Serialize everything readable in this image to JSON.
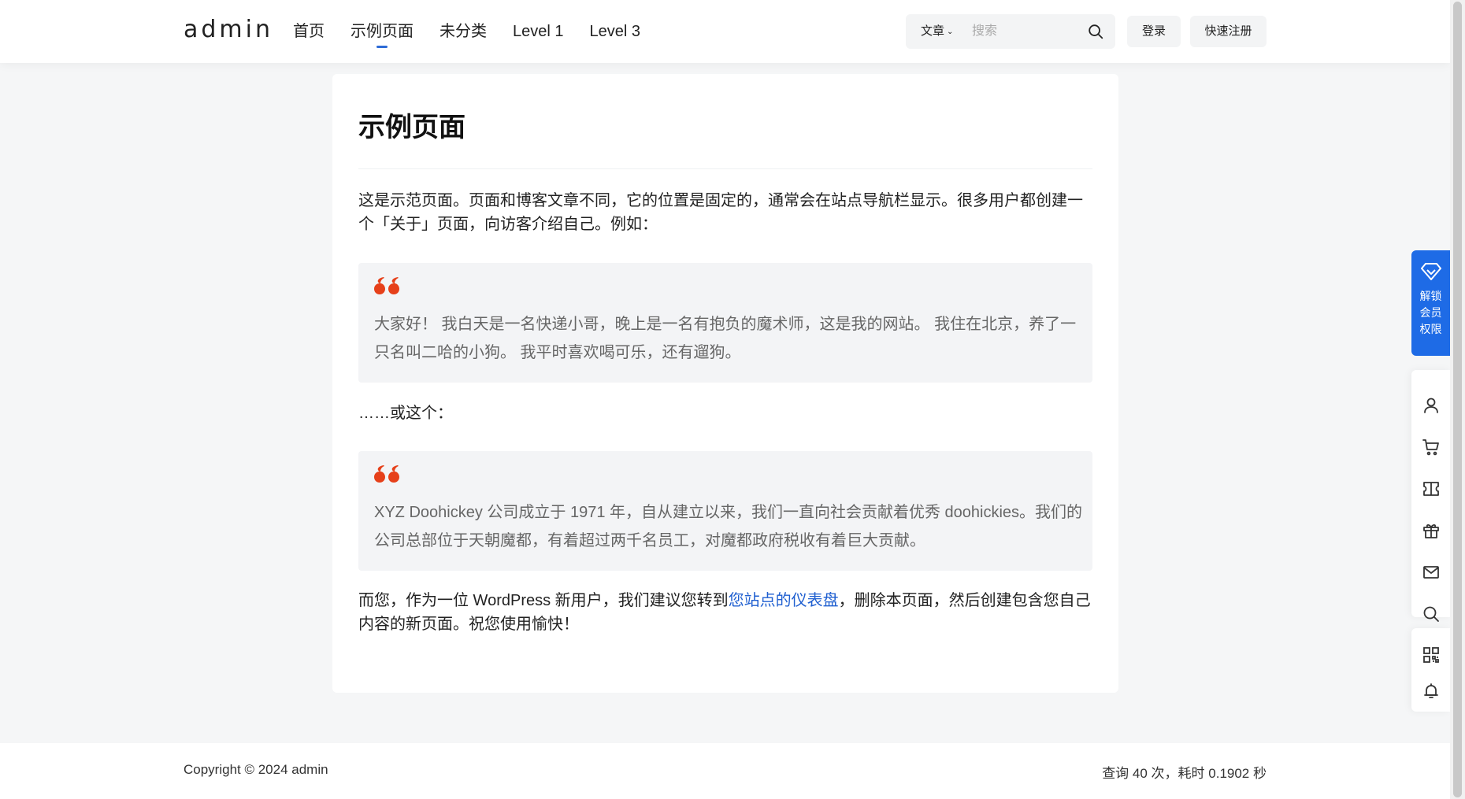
{
  "header": {
    "logo": "admin",
    "nav": [
      {
        "label": "首页",
        "active": false
      },
      {
        "label": "示例页面",
        "active": true
      },
      {
        "label": "未分类",
        "active": false
      },
      {
        "label": "Level 1",
        "active": false
      },
      {
        "label": "Level 3",
        "active": false
      }
    ],
    "search": {
      "category": "文章",
      "placeholder": "搜索",
      "value": ""
    },
    "login_label": "登录",
    "register_label": "快速注册"
  },
  "article": {
    "title": "示例页面",
    "intro": "这是示范页面。页面和博客文章不同，它的位置是固定的，通常会在站点导航栏显示。很多用户都创建一个「关于」页面，向访客介绍自己。例如：",
    "quote1": "大家好！ 我白天是一名快递小哥，晚上是一名有抱负的魔术师，这是我的网站。 我住在北京，养了一只名叫二哈的小狗。 我平时喜欢喝可乐，还有遛狗。",
    "or_this": "……或这个：",
    "quote2": "XYZ Doohickey 公司成立于 1971 年，自从建立以来，我们一直向社会贡献着优秀 doohickies。我们的公司总部位于天朝魔都，有着超过两千名员工，对魔都政府税收有着巨大贡献。",
    "outro_before": "而您，作为一位 WordPress 新用户，我们建议您转到",
    "outro_link": "您站点的仪表盘",
    "outro_after": "，删除本页面，然后创建包含您自己内容的新页面。祝您使用愉快！"
  },
  "footer": {
    "copyright": "Copyright © 2024 admin",
    "stats": "查询 40 次，耗时 0.1902 秒"
  },
  "sidebar": {
    "vip_label": "解锁会员权限",
    "vip_lines": [
      "解锁",
      "会员",
      "权限"
    ],
    "buttons": [
      "user-icon",
      "cart-icon",
      "ticket-icon",
      "gift-icon",
      "mail-icon",
      "search-icon",
      "qrcode-icon",
      "bell-icon"
    ]
  },
  "colors": {
    "accent": "#1e6be6",
    "link": "#1f5fd0",
    "quote_mark": "#e6401a",
    "background": "#f5f6f7"
  }
}
